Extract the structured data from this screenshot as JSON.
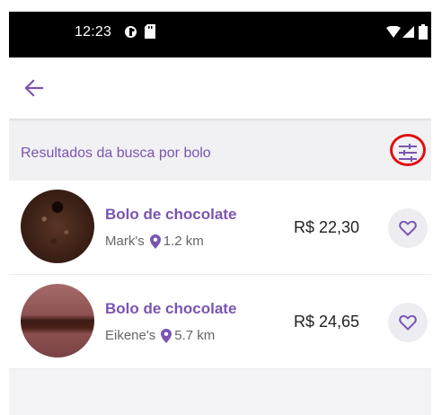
{
  "status_bar": {
    "time": "12:23"
  },
  "app_bar": {
    "back_icon": "arrow-left-icon"
  },
  "search": {
    "results_label": "Resultados da busca por bolo",
    "filter_icon": "tune-sliders-icon"
  },
  "colors": {
    "accent": "#7a55b0",
    "highlight": "#e01010",
    "background": "#f3f3f5"
  },
  "results": [
    {
      "title": "Bolo de chocolate",
      "shop": "Mark's",
      "distance": "1.2 km",
      "price": "R$ 22,30",
      "favorite_icon": "heart-outline-icon"
    },
    {
      "title": "Bolo de chocolate",
      "shop": "Eikene's",
      "distance": "5.7 km",
      "price": "R$ 24,65",
      "favorite_icon": "heart-outline-icon"
    }
  ]
}
